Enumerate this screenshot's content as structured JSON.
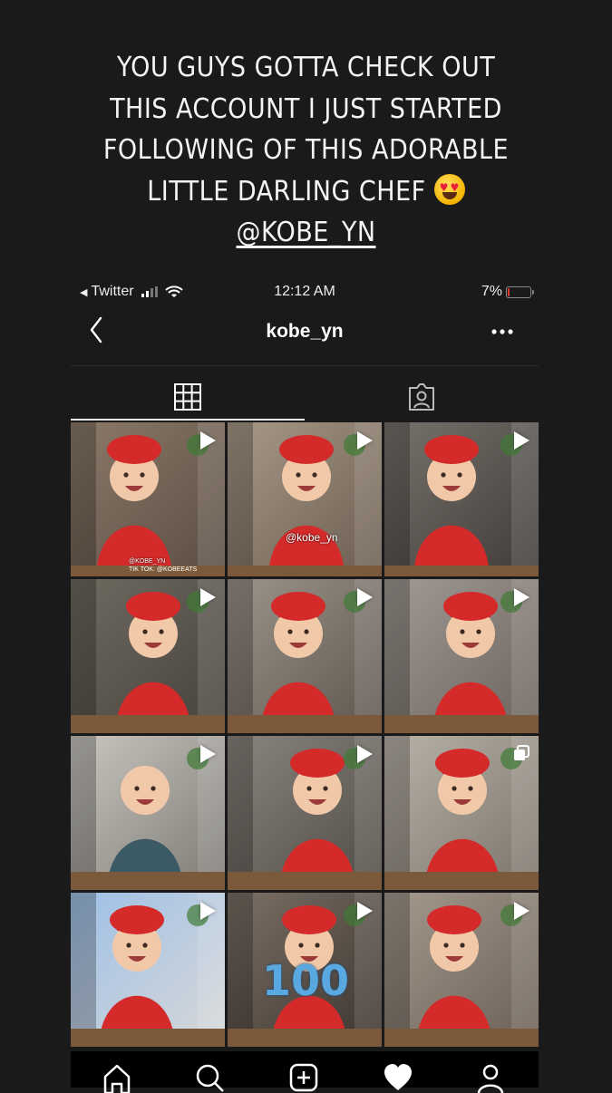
{
  "caption": {
    "line1": "YOU GUYS GOTTA CHECK OUT",
    "line2": "THIS ACCOUNT I JUST STARTED",
    "line3": "FOLLOWING OF THIS ADORABLE",
    "line4": "LITTLE DARLING CHEF",
    "handle": "@KOBE_YN",
    "emoji": "heart-eyes-emoji"
  },
  "status_bar": {
    "back_app": "Twitter",
    "time": "12:12 AM",
    "battery_percent": "7%",
    "battery_level": 0.07
  },
  "profile": {
    "username": "kobe_yn"
  },
  "tabs": [
    {
      "name": "grid",
      "icon": "grid-icon",
      "active": true
    },
    {
      "name": "tagged",
      "icon": "tagged-person-icon",
      "active": false
    }
  ],
  "posts": [
    {
      "type": "video",
      "watermark": "@KOBE_YN",
      "watermark2": "TIK TOK: @KOBEEATS"
    },
    {
      "type": "video",
      "watermark": "@kobe_yn"
    },
    {
      "type": "video"
    },
    {
      "type": "video"
    },
    {
      "type": "video"
    },
    {
      "type": "video"
    },
    {
      "type": "video"
    },
    {
      "type": "video"
    },
    {
      "type": "carousel"
    },
    {
      "type": "video"
    },
    {
      "type": "video",
      "cake_text": "100"
    },
    {
      "type": "video"
    }
  ],
  "bottom_nav": [
    "home-icon",
    "search-icon",
    "new-post-icon",
    "activity-heart-icon",
    "profile-icon"
  ],
  "colors": {
    "background": "#1a1a1b",
    "chef_red": "#d42a2a",
    "battery_low": "#e23b2e"
  }
}
